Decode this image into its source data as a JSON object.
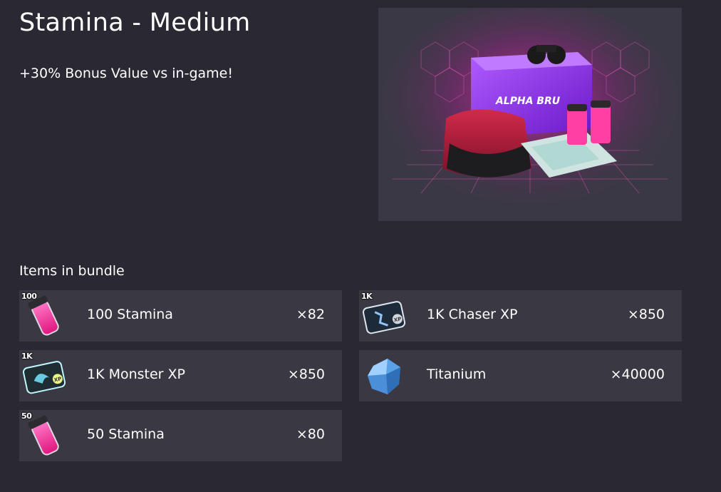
{
  "bundle": {
    "title": "Stamina - Medium",
    "subtitle": "+30% Bonus Value vs in-game!",
    "hero_box_text": "ALPHA BRU"
  },
  "items_section": {
    "label": "Items in bundle",
    "items": [
      {
        "name": "100 Stamina",
        "quantity": "×82",
        "badge": "100",
        "icon": "stamina-vial-icon"
      },
      {
        "name": "1K Chaser XP",
        "quantity": "×850",
        "badge": "1K",
        "icon": "chaser-xp-ticket-icon"
      },
      {
        "name": "1K Monster XP",
        "quantity": "×850",
        "badge": "1K",
        "icon": "monster-xp-ticket-icon"
      },
      {
        "name": "Titanium",
        "quantity": "×40000",
        "badge": "",
        "icon": "titanium-crystal-icon"
      },
      {
        "name": "50 Stamina",
        "quantity": "×80",
        "badge": "50",
        "icon": "stamina-vial-icon"
      }
    ]
  },
  "colors": {
    "background": "#2a2832",
    "card": "#3a3842",
    "accent_pink": "#ff3fa4",
    "accent_purple": "#8a2be2"
  }
}
